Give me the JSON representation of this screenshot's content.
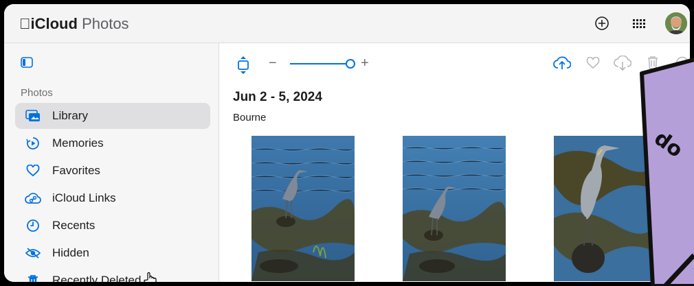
{
  "app": {
    "apple_logo": "",
    "brand_bold": "iCloud",
    "brand_light": "Photos"
  },
  "sidebar": {
    "section_label": "Photos",
    "items": [
      {
        "label": "Library",
        "icon": "library-icon",
        "active": true
      },
      {
        "label": "Memories",
        "icon": "memories-icon"
      },
      {
        "label": "Favorites",
        "icon": "heart-icon"
      },
      {
        "label": "iCloud Links",
        "icon": "icloud-link-icon"
      },
      {
        "label": "Recents",
        "icon": "clock-icon"
      },
      {
        "label": "Hidden",
        "icon": "eye-slash-icon"
      },
      {
        "label": "Recently Deleted",
        "icon": "trash-icon"
      }
    ]
  },
  "main": {
    "zoom_minus": "−",
    "zoom_plus": "+",
    "zoom_level": 1.0,
    "date_range": "Jun 2 - 5, 2024",
    "location": "Bourne"
  },
  "sticker": {
    "text": "do"
  },
  "colors": {
    "accent": "#0071e3",
    "sticker": "#b59fd9"
  }
}
